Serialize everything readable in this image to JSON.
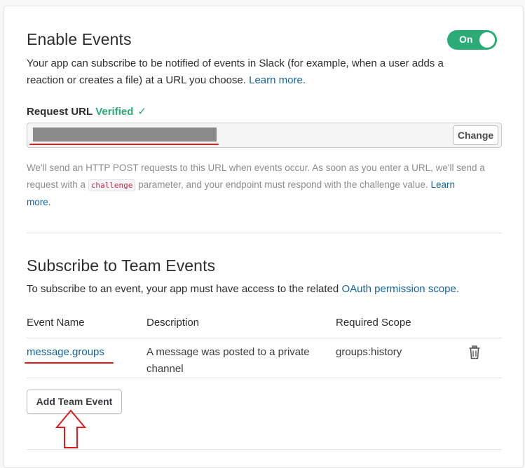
{
  "enable_events": {
    "title": "Enable Events",
    "toggle_label": "On",
    "desc_line1": "Your app can subscribe to be notified of events in Slack (for example, when a user adds a",
    "desc_line2": "reaction or creates a file) at a URL you choose.",
    "learn_more": "Learn more.",
    "request_url_label": "Request URL",
    "verified_label": "Verified",
    "change_button": "Change",
    "help_line1": "We'll send an HTTP POST requests to this URL when events occur. As soon as you enter a URL, we'll send a",
    "help_line2_pre": "request with a",
    "help_code": "challenge",
    "help_line2_post": "parameter, and your endpoint must respond with the challenge value.",
    "help_learn": "Learn",
    "help_more": "more."
  },
  "team_events": {
    "title": "Subscribe to Team Events",
    "desc": "To subscribe to an event, your app must have access to the related",
    "desc_link": "OAuth permission scope.",
    "columns": [
      "Event Name",
      "Description",
      "Required Scope"
    ],
    "rows": [
      {
        "name": "message.groups",
        "description_line1": "A message was posted to a private",
        "description_line2": "channel",
        "scope": "groups:history"
      }
    ],
    "add_button": "Add Team Event"
  },
  "colors": {
    "accent_green": "#2bac76",
    "link_blue": "#1264a3",
    "annotation_red": "#e01b1b"
  },
  "icons": [
    "check-icon",
    "trash-icon",
    "up-arrow-annotation"
  ]
}
